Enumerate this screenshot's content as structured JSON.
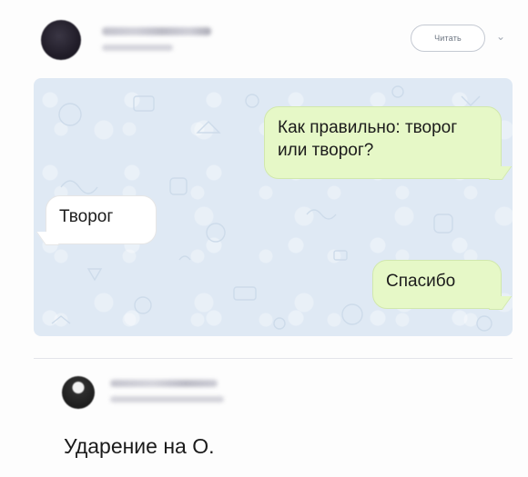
{
  "post": {
    "author_avatar": "avatar-photo",
    "read_button_label": "Читать",
    "menu_icon": "chevron-down-icon"
  },
  "chat": {
    "messages": [
      {
        "side": "outgoing",
        "text": "Как правильно: творог или творог?"
      },
      {
        "side": "incoming",
        "text": "Творог"
      },
      {
        "side": "outgoing",
        "text": "Спасибо"
      }
    ],
    "colors": {
      "background": "#dfe9f4",
      "outgoing_bubble": "#e6f8c7",
      "incoming_bubble": "#ffffff"
    }
  },
  "comment": {
    "author_avatar": "avatar-photo",
    "text": "Ударение на О."
  }
}
